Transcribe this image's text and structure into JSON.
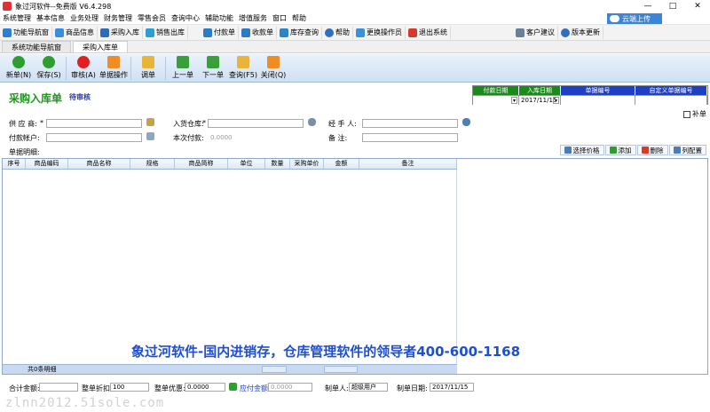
{
  "window": {
    "title": "象过河软件--免费版 V6.4.298",
    "controls": [
      "—",
      "□",
      "✕"
    ]
  },
  "menu": {
    "items": [
      "系统管理",
      "基本信息",
      "业务处理",
      "财务管理",
      "零售会员",
      "查询中心",
      "辅助功能",
      "增值服务",
      "窗口",
      "帮助"
    ],
    "cloud_label": "云端上传"
  },
  "quickbar": {
    "items": [
      "功能导航窗",
      "商品信息",
      "采购入库",
      "销售出库",
      "付款单",
      "收款单",
      "库存查询",
      "帮助",
      "更换操作员",
      "退出系统",
      "客户建议",
      "版本更新"
    ]
  },
  "tabs": [
    "系统功能导航窗",
    "采购入库单"
  ],
  "toolbar": {
    "new": "新单(N)",
    "save": "保存(S)",
    "audit": "审核(A)",
    "ops": "单据操作",
    "transfer": "调单",
    "prev": "上一单",
    "next": "下一单",
    "query": "查询(F5)",
    "close": "关闭(Q)"
  },
  "form": {
    "title": "采购入库单",
    "status": "待审核",
    "header_grid": {
      "cols": [
        "付款日期",
        "入库日期",
        "单据编号",
        "自定义单据编号"
      ],
      "values": [
        "",
        "2017/11/15",
        "",
        ""
      ]
    },
    "supplement": "补单",
    "supplier_label": "供 应 商:",
    "warehouse_label": "入货仓库:",
    "handler_label": "经 手 人:",
    "account_label": "付款帐户:",
    "payment_label": "本次付款:",
    "payment_value": "0.0000",
    "remark_label": "备    注:",
    "detail_label": "单据明细:",
    "required_mark": "*"
  },
  "detail_buttons": {
    "select_price": "选择价格",
    "add": "添加",
    "delete": "删除",
    "column_config": "列配置"
  },
  "grid": {
    "columns": [
      "序号",
      "商品编码",
      "商品名称",
      "规格",
      "商品简称",
      "单位",
      "数量",
      "采购单价",
      "金额",
      "备注"
    ],
    "footer": "共0条明细"
  },
  "promo": "象过河软件-国内进销存，仓库管理软件的领导者400-600-1168",
  "bottom": {
    "total_label": "合计金额:",
    "discount_label": "整单折扣:",
    "discount_value": "100",
    "preferential_label": "整单优惠:",
    "preferential_value": "0.0000",
    "payable_label": "应付金额:",
    "payable_value": "0.0000",
    "maker_label": "制单人:",
    "maker_value": "超级用户",
    "date_label": "制单日期:",
    "date_value": "2017/11/15"
  },
  "watermark": "zlnn2012.51sole.com",
  "colors": {
    "title_green": "#1a9a1a",
    "header_blue": "#1f3fc4",
    "header_green": "#1a8a1a",
    "promo_blue": "#1f4fd0"
  }
}
